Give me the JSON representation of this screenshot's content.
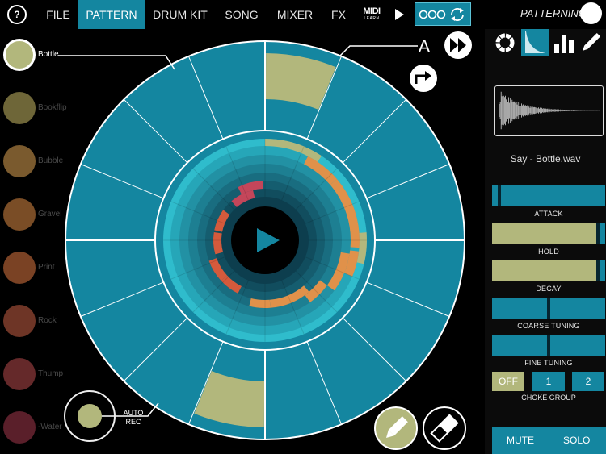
{
  "topbar": {
    "help_label": "?",
    "nav": [
      {
        "label": "FILE",
        "active": false
      },
      {
        "label": "PATTERN",
        "active": true
      },
      {
        "label": "DRUM KIT",
        "active": false
      },
      {
        "label": "SONG",
        "active": false
      },
      {
        "label": "MIXER",
        "active": false
      },
      {
        "label": "FX",
        "active": false
      }
    ],
    "midi_label": "MIDI",
    "midi_sub": "LEARN",
    "play_icon": "play-icon",
    "loop_icon": "cycle-icon"
  },
  "sequencer": {
    "pattern_letter": "A",
    "steps": 16,
    "active_outer_steps": [
      0,
      8
    ]
  },
  "instruments": [
    {
      "name": "Bottle",
      "color": "#b2b77c",
      "selected": true
    },
    {
      "name": "Bookflip",
      "color": "#6e6638",
      "selected": false
    },
    {
      "name": "Bubble",
      "color": "#7a5a2e",
      "selected": false
    },
    {
      "name": "Gravel",
      "color": "#7a4d26",
      "selected": false
    },
    {
      "name": "Print",
      "color": "#7a4224",
      "selected": false
    },
    {
      "name": "Rock",
      "color": "#6e3526",
      "selected": false
    },
    {
      "name": "Thump",
      "color": "#65292a",
      "selected": false
    },
    {
      "name": "-Water",
      "color": "#5a1f2a",
      "selected": false
    }
  ],
  "auto_rec": {
    "line1": "AUTO",
    "line2": "REC"
  },
  "right_panel": {
    "title": "PATTERNING",
    "sample_name": "Say - Bottle.wav",
    "params": [
      {
        "label": "ATTACK",
        "value": 0.05
      },
      {
        "label": "HOLD",
        "value": 0.95
      },
      {
        "label": "DECAY",
        "value": 0.95
      },
      {
        "label": "COARSE TUNING",
        "value": 0.5
      },
      {
        "label": "FINE TUNING",
        "value": 0.5
      }
    ],
    "choke": {
      "label": "CHOKE GROUP",
      "options": [
        "OFF",
        "1",
        "2"
      ],
      "selected": "OFF"
    },
    "mute_label": "MUTE",
    "solo_label": "SOLO"
  },
  "colors": {
    "accent": "#1486a0",
    "step_on": "#b2b77c",
    "orange": "#e0914a",
    "red": "#d45a3c",
    "pink": "#c4465a"
  }
}
